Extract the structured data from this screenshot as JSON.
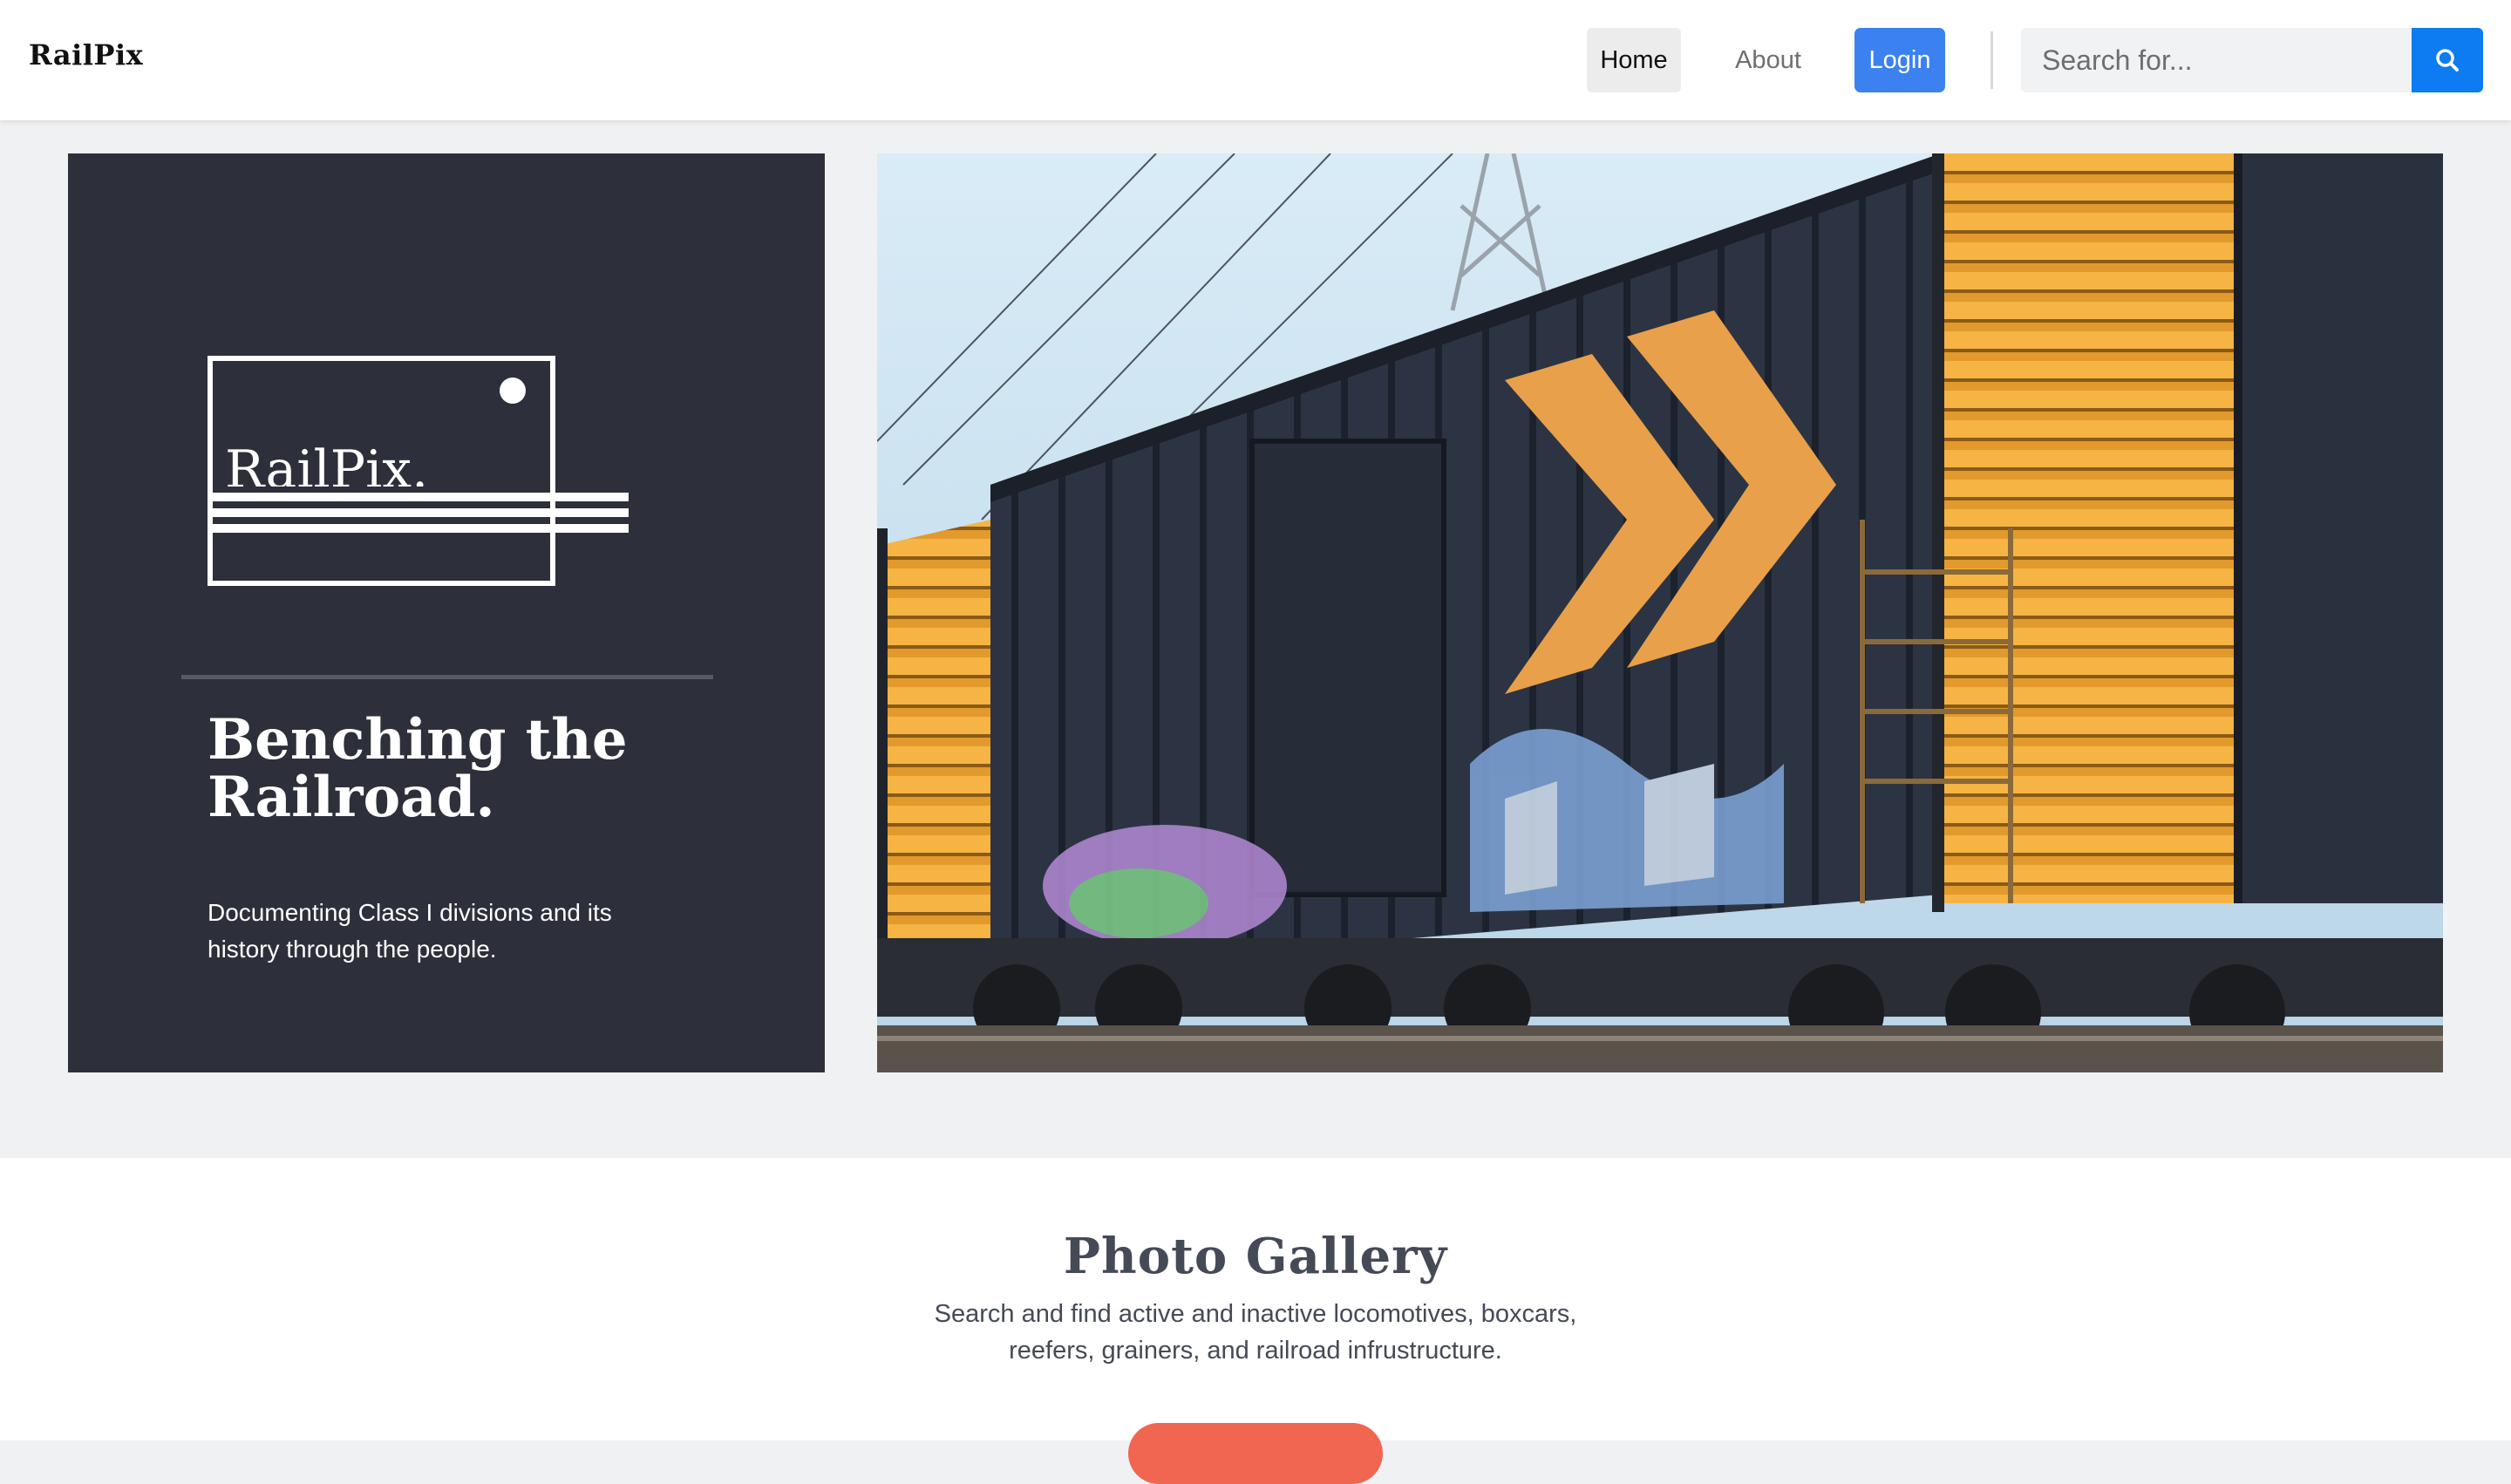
{
  "navbar": {
    "brand": "RailPix",
    "links": {
      "home": "Home",
      "about": "About",
      "login": "Login"
    },
    "search": {
      "placeholder": "Search for...",
      "value": ""
    }
  },
  "hero": {
    "logo_text": "RailPix.",
    "title_line1": "Benching the",
    "title_line2": "Railroad.",
    "subtitle": "Documenting Class I divisions and its history through the people."
  },
  "gallery": {
    "title": "Photo Gallery",
    "description": "Search and find active and inactive locomotives, boxcars, reefers, grainers, and railroad infrustructure."
  },
  "colors": {
    "panel": "#2d2f3b",
    "primary": "#3b82f0",
    "search_button": "#0d7bf2",
    "cta": "#f06650",
    "boxcar_orange": "#f2a93b"
  },
  "icons": {
    "search": "search-icon"
  }
}
